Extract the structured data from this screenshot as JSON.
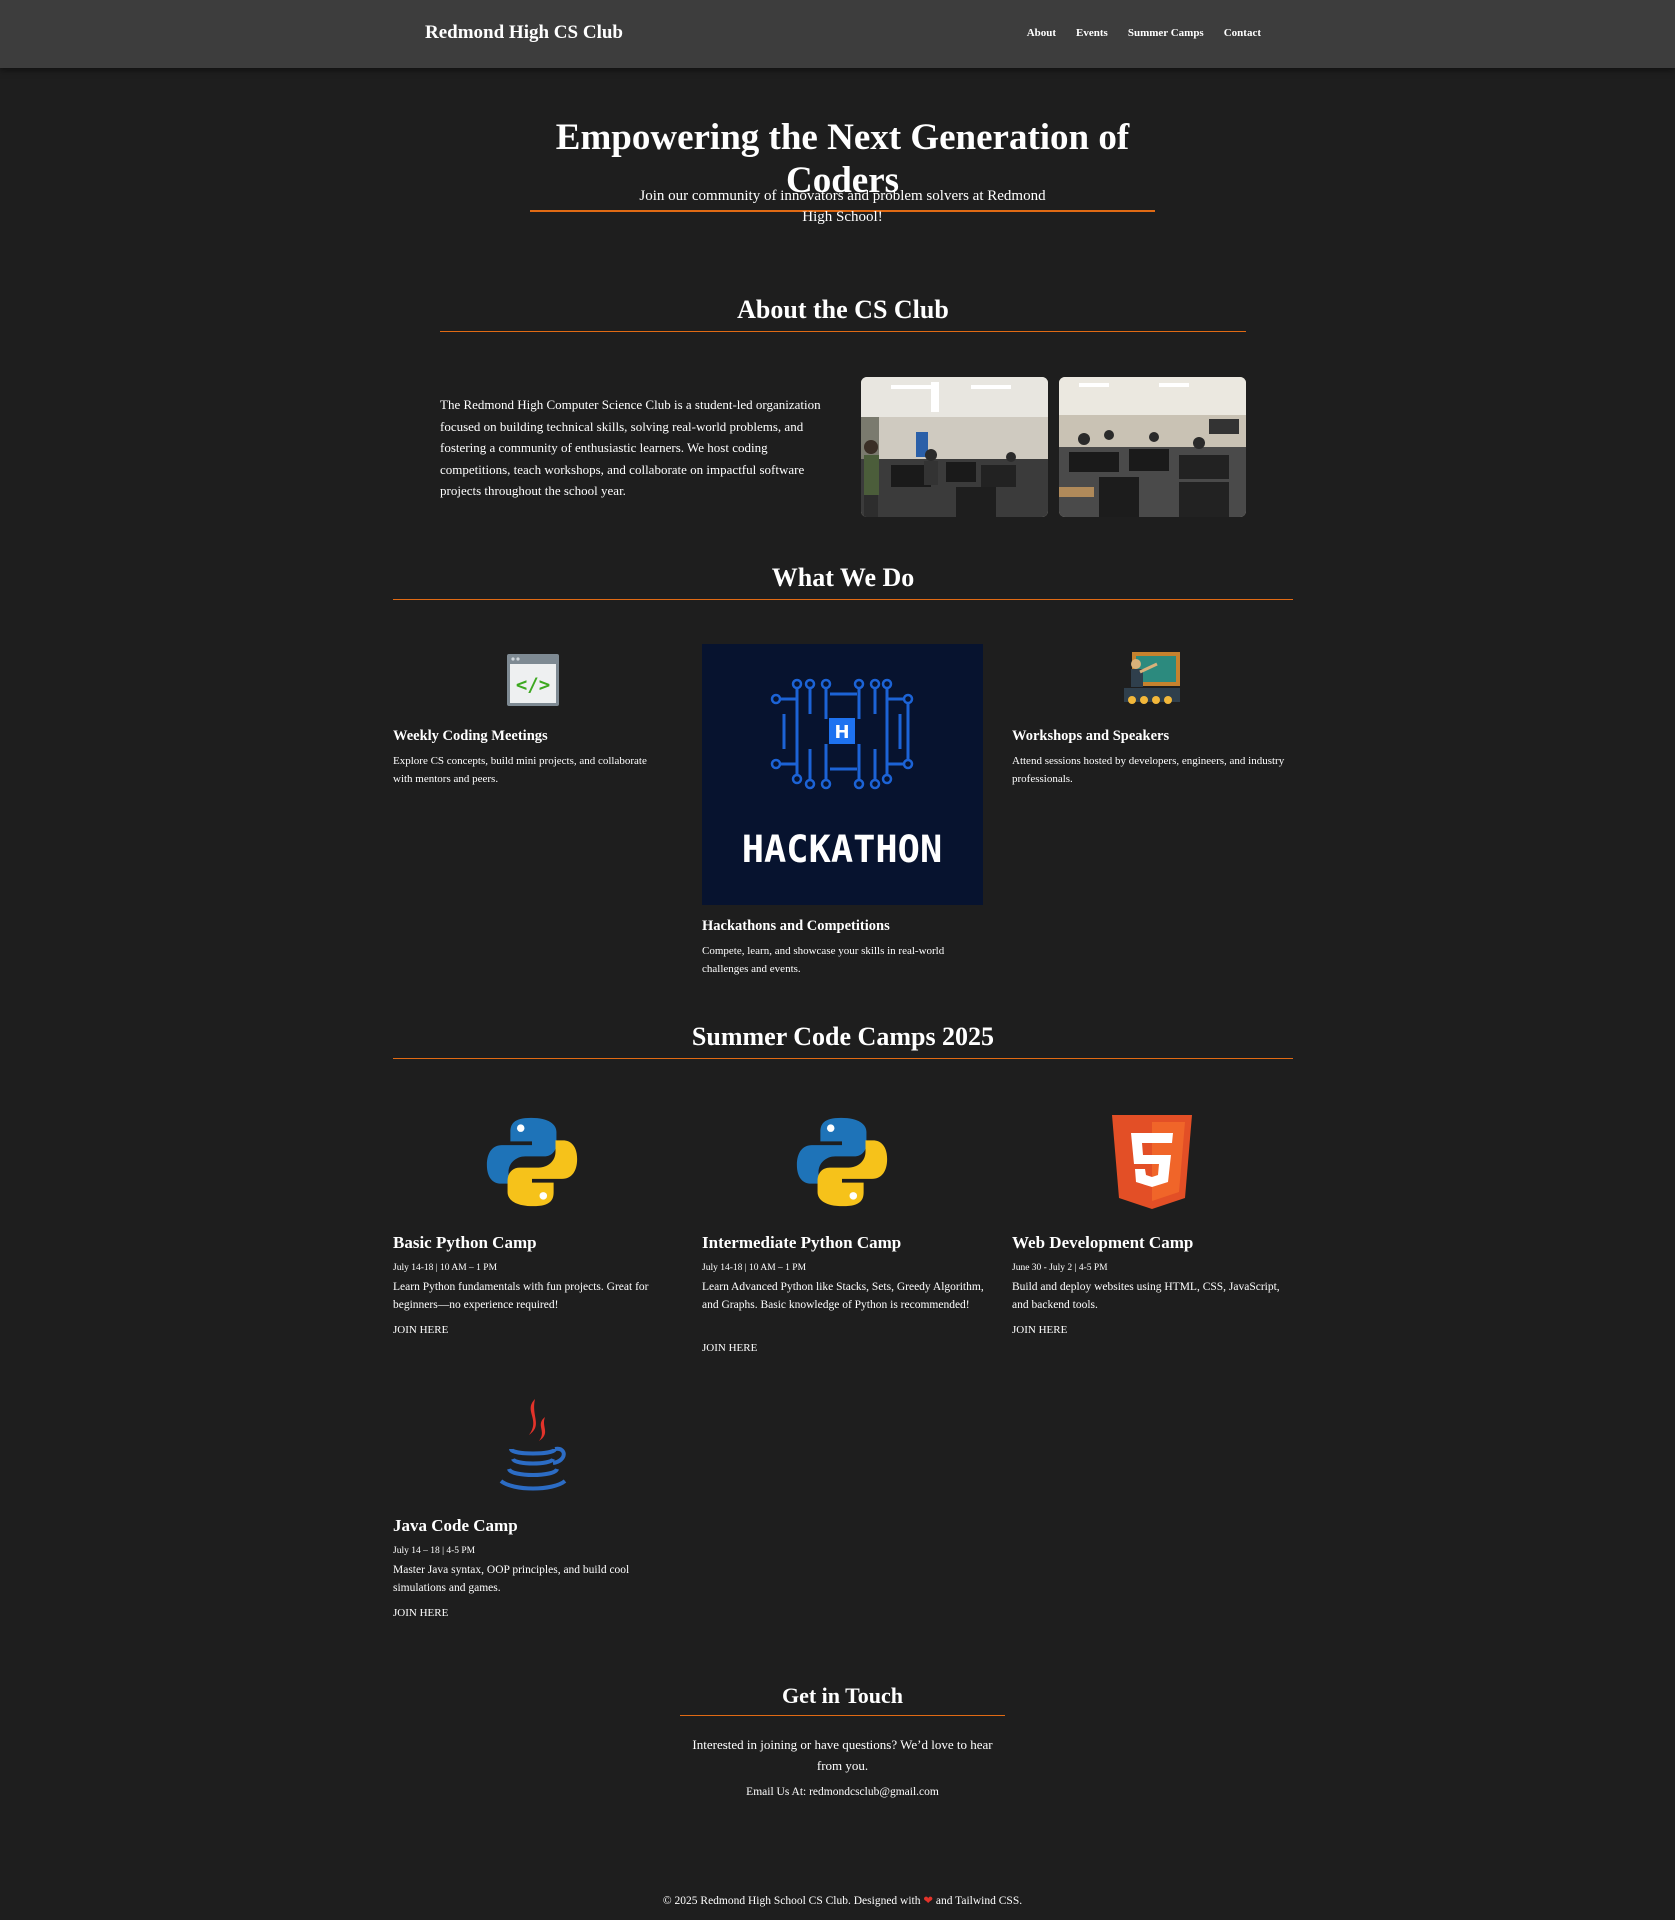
{
  "nav": {
    "brand": "Redmond High CS Club",
    "links": [
      "About",
      "Events",
      "Summer Camps",
      "Contact"
    ]
  },
  "hero": {
    "title": "Empowering the Next Generation of Coders",
    "subtitle": "Join our community of innovators and problem solvers at Redmond High School!"
  },
  "about": {
    "title": "About the CS Club",
    "text": "The Redmond High Computer Science Club is a student-led organization focused on building technical skills, solving real-world problems, and fostering a community of enthusiastic learners. We host coding competitions, teach workshops, and collaborate on impactful software projects throughout the school year."
  },
  "what_we_do": {
    "title": "What We Do",
    "cards": [
      {
        "title": "Weekly Coding Meetings",
        "desc": "Explore CS concepts, build mini projects, and collaborate with mentors and peers.",
        "icon": "code-window-icon"
      },
      {
        "title": "Hackathons and Competitions",
        "desc": "Compete, learn, and showcase your skills in real-world challenges and events.",
        "image_text": "HACKATHON"
      },
      {
        "title": "Workshops and Speakers",
        "desc": "Attend sessions hosted by developers, engineers, and industry professionals.",
        "icon": "presentation-icon"
      }
    ]
  },
  "camps": {
    "title": "Summer Code Camps 2025",
    "items": [
      {
        "title": "Basic Python Camp",
        "date": "July 14-18 | 10 AM – 1 PM",
        "desc": "Learn Python fundamentals with fun projects. Great for beginners—no experience required!",
        "link": "JOIN HERE",
        "icon": "python-icon"
      },
      {
        "title": "Intermediate Python Camp",
        "date": "July 14-18 | 10 AM – 1 PM",
        "desc": "Learn Advanced Python like Stacks, Sets, Greedy Algorithm, and Graphs. Basic knowledge of Python is recommended!",
        "link": "JOIN HERE",
        "icon": "python-icon"
      },
      {
        "title": "Web Development Camp",
        "date": "June 30 - July 2 | 4-5 PM",
        "desc": "Build and deploy websites using HTML, CSS, JavaScript, and backend tools.",
        "link": "JOIN HERE",
        "icon": "html5-icon"
      },
      {
        "title": "Java Code Camp",
        "date": "July 14 – 18 | 4-5 PM",
        "desc": "Master Java syntax, OOP principles, and build cool simulations and games.",
        "link": "JOIN HERE",
        "icon": "java-icon"
      }
    ]
  },
  "contact": {
    "title": "Get in Touch",
    "text": "Interested in joining or have questions? We’d love to hear from you.",
    "email_line": "Email Us At: redmondcsclub@gmail.com"
  },
  "footer": {
    "pre": "© 2025 Redmond High School CS Club. Designed with",
    "post": "and Tailwind CSS."
  },
  "colors": {
    "accent": "#e06a14",
    "background": "#1e1e1e",
    "navbar": "#3d3d3d"
  }
}
